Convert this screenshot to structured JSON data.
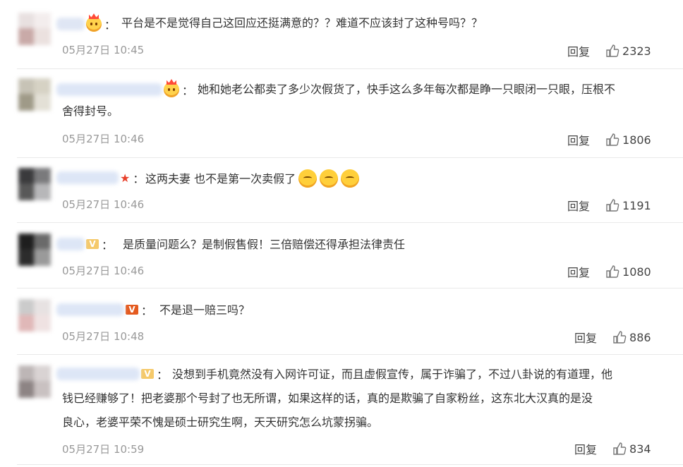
{
  "comments": [
    {
      "text": "平台是不是觉得自己这回应还挺满意的？？难道不应该封了这种号吗？？",
      "time": "05月27日 10:45",
      "reply_label": "回复",
      "likes": "2323",
      "badge": "crown-icon"
    },
    {
      "text_line1": "她和她老公都卖了多少次假货了，快手这么多年每次都是睁一只眼闭一只眼，压根不",
      "text_line2": "舍得封号。",
      "time": "05月27日 10:46",
      "reply_label": "回复",
      "likes": "1806",
      "badge": "crown-icon"
    },
    {
      "text": "这两夫妻 也不是第一次卖假了",
      "time": "05月27日 10:46",
      "reply_label": "回复",
      "likes": "1191",
      "badge": "star-icon",
      "emoji_count": 3
    },
    {
      "text": "是质量问题么？是制假售假！三倍赔偿还得承担法律责任",
      "time": "05月27日 10:46",
      "reply_label": "回复",
      "likes": "1080",
      "badge": "v-badge-icon"
    },
    {
      "text": "不是退一赔三吗？",
      "time": "05月27日 10:48",
      "reply_label": "回复",
      "likes": "886",
      "badge": "v-badge-icon"
    },
    {
      "text_line1": "没想到手机竟然没有入网许可证，而且虚假宣传，属于诈骗了，不过八卦说的有道理，他",
      "text_line2": "钱已经赚够了！把老婆那个号封了也无所谓，如果这样的话，真的是欺骗了自家粉丝，这东北大汉真的是没",
      "text_line3": "良心，老婆平荣不愧是硕士研究生啊，天天研究怎么坑蒙拐骗。",
      "time": "05月27日 10:59",
      "reply_label": "回复",
      "likes": "834",
      "badge": "v-badge-icon"
    }
  ],
  "colon": "：",
  "v_letter": "V",
  "star_glyph": "★",
  "colors": {
    "text": "#333333",
    "meta": "#999999",
    "separator": "#e9e9e9",
    "crown": "#ffd24c",
    "vip": "#f5c96a"
  }
}
